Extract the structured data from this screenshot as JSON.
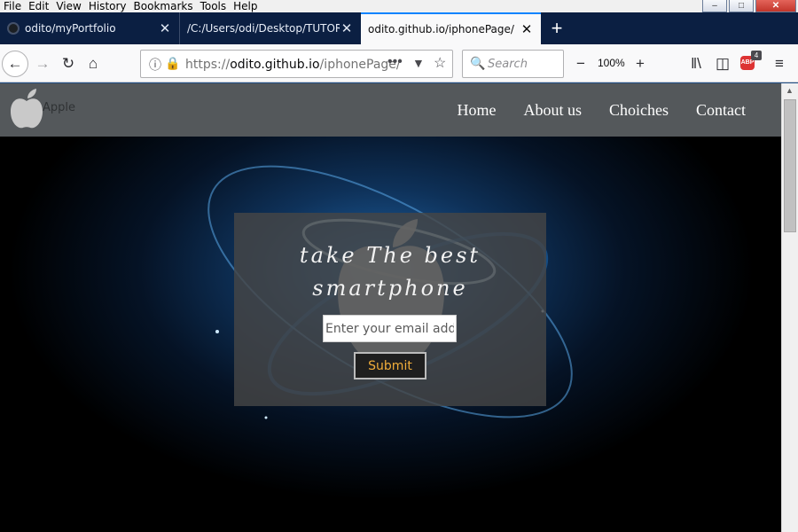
{
  "menubar": {
    "items": [
      "File",
      "Edit",
      "View",
      "History",
      "Bookmarks",
      "Tools",
      "Help"
    ]
  },
  "tabs": [
    {
      "title": "odito/myPortfolio",
      "icon": "github-icon",
      "active": false
    },
    {
      "title": "/C:/Users/odi/Desktop/TUTORIALS/",
      "active": false
    },
    {
      "title": "odito.github.io/iphonePage/",
      "active": true
    }
  ],
  "navbar": {
    "url_prefix": "https://",
    "url_host": "odito.github.io",
    "url_path": "/iphonePage/",
    "search_placeholder": "Search",
    "zoom": "100%",
    "badge": "4",
    "abp_label": "ABP"
  },
  "page": {
    "logo_text": "Apple",
    "nav": [
      "Home",
      "About us",
      "Choiches",
      "Contact"
    ],
    "headline_line1": "take The best",
    "headline_line2": "smartphone",
    "email_placeholder": "Enter your email address",
    "submit_label": "Submit"
  },
  "colors": {
    "accent": "#0a84ff",
    "tab_bg": "#0b1f42",
    "header_bg": "#54585b",
    "submit_text": "#f0ad3a"
  }
}
